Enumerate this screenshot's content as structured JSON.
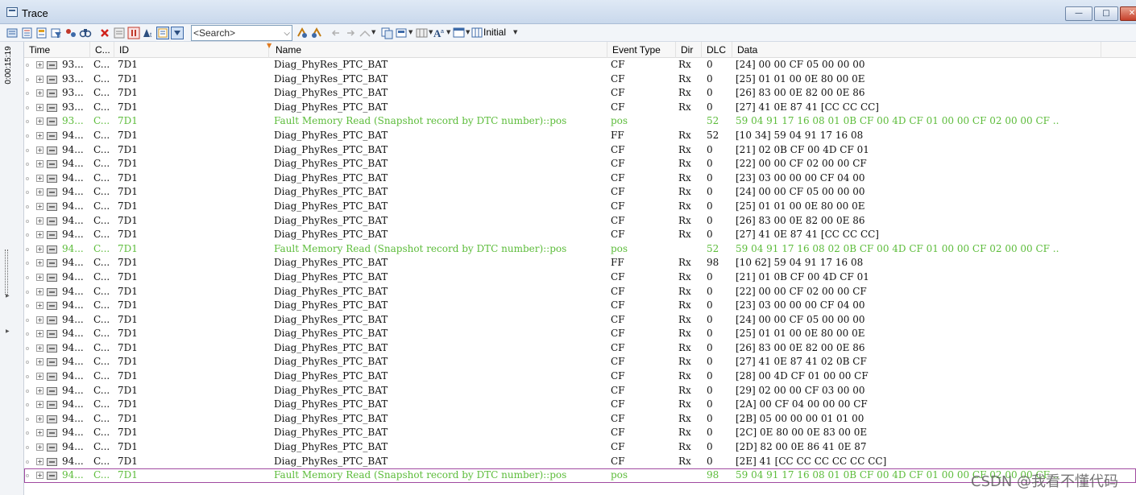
{
  "window": {
    "title": "Trace"
  },
  "toolbar": {
    "search_placeholder": "<Search>",
    "layout_label": "Initial"
  },
  "sidebar": {
    "time_readout": "0:00:15:19"
  },
  "columns": {
    "time": "Time",
    "chn": "C...",
    "id": "ID",
    "name": "Name",
    "event_type": "Event Type",
    "dir": "Dir",
    "dlc": "DLC",
    "data": "Data"
  },
  "colors": {
    "fault_text": "#5cbc3a",
    "selection_border": "#a04aa0"
  },
  "rows": [
    {
      "time": "93...",
      "chn": "C...",
      "id": "7D1",
      "name": "Diag_PhyRes_PTC_BAT",
      "event_type": "CF",
      "dir": "Rx",
      "dlc": "0",
      "data": "[24] 00 00 CF 05 00 00 00",
      "fault": false
    },
    {
      "time": "93...",
      "chn": "C...",
      "id": "7D1",
      "name": "Diag_PhyRes_PTC_BAT",
      "event_type": "CF",
      "dir": "Rx",
      "dlc": "0",
      "data": "[25] 01 01 00 0E 80 00 0E",
      "fault": false
    },
    {
      "time": "93...",
      "chn": "C...",
      "id": "7D1",
      "name": "Diag_PhyRes_PTC_BAT",
      "event_type": "CF",
      "dir": "Rx",
      "dlc": "0",
      "data": "[26] 83 00 0E 82 00 0E 86",
      "fault": false
    },
    {
      "time": "93...",
      "chn": "C...",
      "id": "7D1",
      "name": "Diag_PhyRes_PTC_BAT",
      "event_type": "CF",
      "dir": "Rx",
      "dlc": "0",
      "data": "[27] 41 0E 87 41 [CC CC CC]",
      "fault": false
    },
    {
      "time": "93...",
      "chn": "C...",
      "id": "7D1",
      "name": "Fault Memory Read (Snapshot record by DTC number)::pos",
      "event_type": "pos",
      "dir": "",
      "dlc": "52",
      "data": "59 04 91 17 16 08 01 0B CF 00 4D CF 01 00 00 CF 02 00 00 CF  ..",
      "fault": true
    },
    {
      "time": "94...",
      "chn": "C...",
      "id": "7D1",
      "name": "Diag_PhyRes_PTC_BAT",
      "event_type": "FF",
      "dir": "Rx",
      "dlc": "52",
      "data": "[10 34] 59 04 91 17 16 08",
      "fault": false
    },
    {
      "time": "94...",
      "chn": "C...",
      "id": "7D1",
      "name": "Diag_PhyRes_PTC_BAT",
      "event_type": "CF",
      "dir": "Rx",
      "dlc": "0",
      "data": "[21] 02 0B CF 00 4D CF 01",
      "fault": false
    },
    {
      "time": "94...",
      "chn": "C...",
      "id": "7D1",
      "name": "Diag_PhyRes_PTC_BAT",
      "event_type": "CF",
      "dir": "Rx",
      "dlc": "0",
      "data": "[22] 00 00 CF 02 00 00 CF",
      "fault": false
    },
    {
      "time": "94...",
      "chn": "C...",
      "id": "7D1",
      "name": "Diag_PhyRes_PTC_BAT",
      "event_type": "CF",
      "dir": "Rx",
      "dlc": "0",
      "data": "[23] 03 00 00 00 CF 04 00",
      "fault": false
    },
    {
      "time": "94...",
      "chn": "C...",
      "id": "7D1",
      "name": "Diag_PhyRes_PTC_BAT",
      "event_type": "CF",
      "dir": "Rx",
      "dlc": "0",
      "data": "[24] 00 00 CF 05 00 00 00",
      "fault": false
    },
    {
      "time": "94...",
      "chn": "C...",
      "id": "7D1",
      "name": "Diag_PhyRes_PTC_BAT",
      "event_type": "CF",
      "dir": "Rx",
      "dlc": "0",
      "data": "[25] 01 01 00 0E 80 00 0E",
      "fault": false
    },
    {
      "time": "94...",
      "chn": "C...",
      "id": "7D1",
      "name": "Diag_PhyRes_PTC_BAT",
      "event_type": "CF",
      "dir": "Rx",
      "dlc": "0",
      "data": "[26] 83 00 0E 82 00 0E 86",
      "fault": false
    },
    {
      "time": "94...",
      "chn": "C...",
      "id": "7D1",
      "name": "Diag_PhyRes_PTC_BAT",
      "event_type": "CF",
      "dir": "Rx",
      "dlc": "0",
      "data": "[27] 41 0E 87 41 [CC CC CC]",
      "fault": false
    },
    {
      "time": "94...",
      "chn": "C...",
      "id": "7D1",
      "name": "Fault Memory Read (Snapshot record by DTC number)::pos",
      "event_type": "pos",
      "dir": "",
      "dlc": "52",
      "data": "59 04 91 17 16 08 02 0B CF 00 4D CF 01 00 00 CF 02 00 00 CF  ..",
      "fault": true
    },
    {
      "time": "94...",
      "chn": "C...",
      "id": "7D1",
      "name": "Diag_PhyRes_PTC_BAT",
      "event_type": "FF",
      "dir": "Rx",
      "dlc": "98",
      "data": "[10 62] 59 04 91 17 16 08",
      "fault": false
    },
    {
      "time": "94...",
      "chn": "C...",
      "id": "7D1",
      "name": "Diag_PhyRes_PTC_BAT",
      "event_type": "CF",
      "dir": "Rx",
      "dlc": "0",
      "data": "[21] 01 0B CF 00 4D CF 01",
      "fault": false
    },
    {
      "time": "94...",
      "chn": "C...",
      "id": "7D1",
      "name": "Diag_PhyRes_PTC_BAT",
      "event_type": "CF",
      "dir": "Rx",
      "dlc": "0",
      "data": "[22] 00 00 CF 02 00 00 CF",
      "fault": false
    },
    {
      "time": "94...",
      "chn": "C...",
      "id": "7D1",
      "name": "Diag_PhyRes_PTC_BAT",
      "event_type": "CF",
      "dir": "Rx",
      "dlc": "0",
      "data": "[23] 03 00 00 00 CF 04 00",
      "fault": false
    },
    {
      "time": "94...",
      "chn": "C...",
      "id": "7D1",
      "name": "Diag_PhyRes_PTC_BAT",
      "event_type": "CF",
      "dir": "Rx",
      "dlc": "0",
      "data": "[24] 00 00 CF 05 00 00 00",
      "fault": false
    },
    {
      "time": "94...",
      "chn": "C...",
      "id": "7D1",
      "name": "Diag_PhyRes_PTC_BAT",
      "event_type": "CF",
      "dir": "Rx",
      "dlc": "0",
      "data": "[25] 01 01 00 0E 80 00 0E",
      "fault": false
    },
    {
      "time": "94...",
      "chn": "C...",
      "id": "7D1",
      "name": "Diag_PhyRes_PTC_BAT",
      "event_type": "CF",
      "dir": "Rx",
      "dlc": "0",
      "data": "[26] 83 00 0E 82 00 0E 86",
      "fault": false
    },
    {
      "time": "94...",
      "chn": "C...",
      "id": "7D1",
      "name": "Diag_PhyRes_PTC_BAT",
      "event_type": "CF",
      "dir": "Rx",
      "dlc": "0",
      "data": "[27] 41 0E 87 41 02 0B CF",
      "fault": false
    },
    {
      "time": "94...",
      "chn": "C...",
      "id": "7D1",
      "name": "Diag_PhyRes_PTC_BAT",
      "event_type": "CF",
      "dir": "Rx",
      "dlc": "0",
      "data": "[28] 00 4D CF 01 00 00 CF",
      "fault": false
    },
    {
      "time": "94...",
      "chn": "C...",
      "id": "7D1",
      "name": "Diag_PhyRes_PTC_BAT",
      "event_type": "CF",
      "dir": "Rx",
      "dlc": "0",
      "data": "[29] 02 00 00 CF 03 00 00",
      "fault": false
    },
    {
      "time": "94...",
      "chn": "C...",
      "id": "7D1",
      "name": "Diag_PhyRes_PTC_BAT",
      "event_type": "CF",
      "dir": "Rx",
      "dlc": "0",
      "data": "[2A] 00 CF 04 00 00 00 CF",
      "fault": false
    },
    {
      "time": "94...",
      "chn": "C...",
      "id": "7D1",
      "name": "Diag_PhyRes_PTC_BAT",
      "event_type": "CF",
      "dir": "Rx",
      "dlc": "0",
      "data": "[2B] 05 00 00 00 01 01 00",
      "fault": false
    },
    {
      "time": "94...",
      "chn": "C...",
      "id": "7D1",
      "name": "Diag_PhyRes_PTC_BAT",
      "event_type": "CF",
      "dir": "Rx",
      "dlc": "0",
      "data": "[2C] 0E 80 00 0E 83 00 0E",
      "fault": false
    },
    {
      "time": "94...",
      "chn": "C...",
      "id": "7D1",
      "name": "Diag_PhyRes_PTC_BAT",
      "event_type": "CF",
      "dir": "Rx",
      "dlc": "0",
      "data": "[2D] 82 00 0E 86 41 0E 87",
      "fault": false
    },
    {
      "time": "94...",
      "chn": "C...",
      "id": "7D1",
      "name": "Diag_PhyRes_PTC_BAT",
      "event_type": "CF",
      "dir": "Rx",
      "dlc": "0",
      "data": "[2E] 41 [CC CC CC CC CC CC]",
      "fault": false
    },
    {
      "time": "94...",
      "chn": "C...",
      "id": "7D1",
      "name": "Fault Memory Read (Snapshot record by DTC number)::pos",
      "event_type": "pos",
      "dir": "",
      "dlc": "98",
      "data": "59 04 91 17 16 08 01 0B CF 00 4D CF 01 00 00 CF 02 00 00 CF  ..",
      "fault": true,
      "selected": true
    }
  ],
  "watermark": "CSDN @我看不懂代码"
}
